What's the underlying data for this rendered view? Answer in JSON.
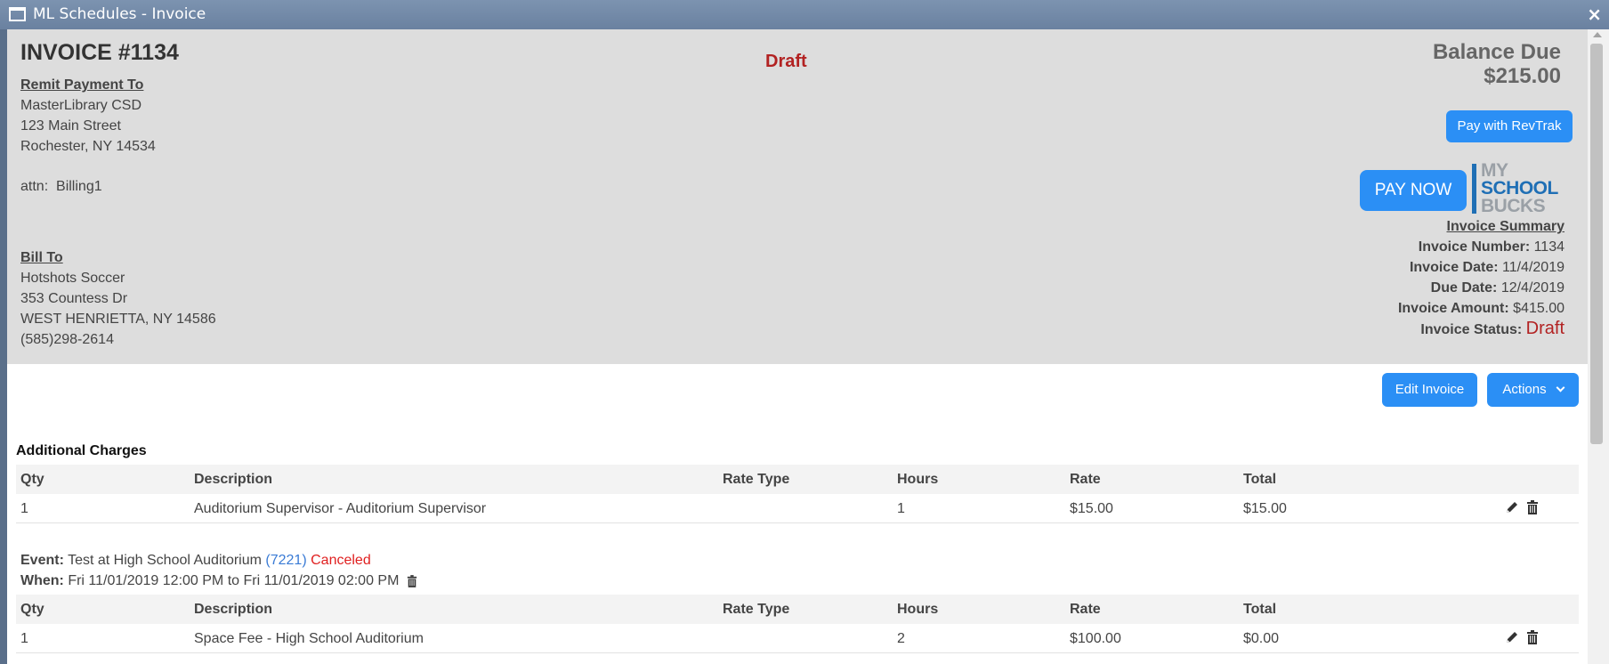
{
  "window": {
    "title": "ML Schedules - Invoice",
    "close": "×"
  },
  "invoice": {
    "title": "INVOICE #1134",
    "status_banner": "Draft",
    "remit": {
      "label": "Remit Payment To",
      "name": "MasterLibrary CSD",
      "street": "123 Main Street",
      "city": "Rochester, NY 14534",
      "attn": "attn:  Billing1"
    },
    "bill_to": {
      "label": "Bill To",
      "name": "Hotshots Soccer",
      "street": "353 Countess Dr",
      "city": "WEST HENRIETTA, NY 14586",
      "phone": "(585)298-2614"
    },
    "balance": {
      "label": "Balance Due",
      "amount": "$215.00"
    },
    "pay_revtrak_label": "Pay with RevTrak",
    "pay_now_label": "PAY NOW",
    "logo": {
      "line1": "MY",
      "line2": "SCHOOL",
      "line3": "BUCKS"
    },
    "summary": {
      "heading": "Invoice Summary",
      "number_label": "Invoice Number:",
      "number": "1134",
      "date_label": "Invoice Date:",
      "date": "11/4/2019",
      "due_label": "Due Date:",
      "due": "12/4/2019",
      "amount_label": "Invoice Amount:",
      "amount": "$415.00",
      "status_label": "Invoice Status:",
      "status": "Draft"
    }
  },
  "toolbar": {
    "edit_label": "Edit Invoice",
    "actions_label": "Actions"
  },
  "additional_charges": {
    "title": "Additional Charges",
    "headers": {
      "qty": "Qty",
      "desc": "Description",
      "rate_type": "Rate Type",
      "hours": "Hours",
      "rate": "Rate",
      "total": "Total"
    },
    "rows": [
      {
        "qty": "1",
        "desc": "Auditorium Supervisor - Auditorium Supervisor",
        "rate_type": "",
        "hours": "1",
        "rate": "$15.00",
        "total": "$15.00"
      }
    ]
  },
  "event": {
    "event_label": "Event:",
    "name": "Test at High School Auditorium",
    "id": "(7221)",
    "status": "Canceled",
    "when_label": "When:",
    "when": "Fri 11/01/2019 12:00 PM to Fri 11/01/2019 02:00 PM",
    "headers": {
      "qty": "Qty",
      "desc": "Description",
      "rate_type": "Rate Type",
      "hours": "Hours",
      "rate": "Rate",
      "total": "Total"
    },
    "rows": [
      {
        "qty": "1",
        "desc": "Space Fee - High School Auditorium",
        "rate_type": "",
        "hours": "2",
        "rate": "$100.00",
        "total": "$0.00"
      }
    ]
  }
}
